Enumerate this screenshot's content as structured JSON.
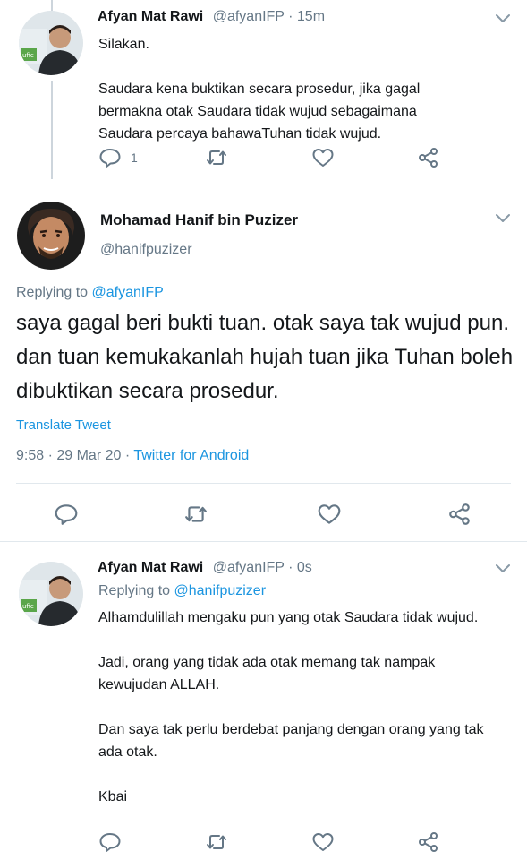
{
  "tweet1": {
    "name": "Afyan Mat Rawi",
    "handle": "@afyanIFP",
    "sep": " · ",
    "time": "15m",
    "text": "Silakan.\n\nSaudara kena buktikan secara prosedur, jika gagal bermakna otak Saudara tidak wujud  sebagaimana Saudara percaya bahawaTuhan tidak wujud.",
    "reply_count": "1",
    "avatar_icon": "person-avatar-icon"
  },
  "main_tweet": {
    "name": "Mohamad Hanif bin Puzizer",
    "handle": "@hanifpuzizer",
    "replying_label": "Replying to ",
    "replying_handle": "@afyanIFP",
    "text": "saya gagal beri bukti tuan. otak saya tak wujud pun. dan tuan kemukakanlah hujah tuan jika Tuhan boleh dibuktikan secara prosedur.",
    "translate": "Translate Tweet",
    "time": "9:58 · 29 Mar 20 · ",
    "source": "Twitter for Android"
  },
  "tweet3": {
    "name": "Afyan Mat Rawi",
    "handle": "@afyanIFP",
    "sep": " · ",
    "time": "0s",
    "replying_label": "Replying to ",
    "replying_handle": "@hanifpuzizer",
    "text": "Alhamdulillah mengaku pun yang otak Saudara tidak wujud.\n\nJadi, orang yang tidak ada otak memang tak nampak kewujudan ALLAH.\n\nDan saya tak perlu berdebat panjang dengan orang yang tak ada otak.\n\nKbai"
  },
  "colors": {
    "accent": "#1b95e0",
    "secondary_text": "#657786",
    "primary_text": "#14171a",
    "divider": "#e1e8ed"
  }
}
